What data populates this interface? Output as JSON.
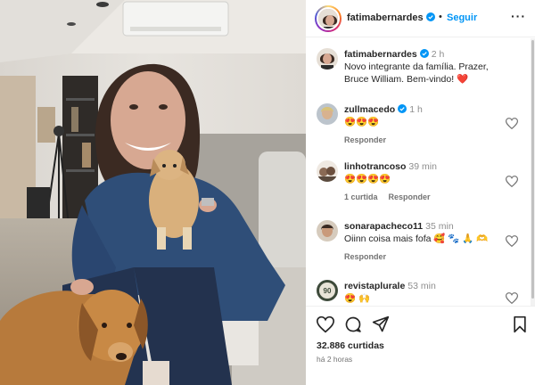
{
  "post": {
    "author": "fatimabernardes",
    "follow_label": "Seguir",
    "separator": "•",
    "more_label": "···",
    "caption": {
      "author": "fatimabernardes",
      "time": "2 h",
      "text": "Novo integrante da família. Prazer, Bruce William. Bem-vindo! ",
      "emoji": "❤️"
    }
  },
  "comments": [
    {
      "user": "zullmacedo",
      "verified": true,
      "time": "1 h",
      "text": "😍😍😍",
      "actions": [
        "Responder"
      ]
    },
    {
      "user": "linhotrancoso",
      "verified": false,
      "time": "39 min",
      "text": "😍😍😍😍",
      "actions": [
        "1 curtida",
        "Responder"
      ]
    },
    {
      "user": "sonarapacheco11",
      "verified": false,
      "time": "35 min",
      "text": "Oiinn coisa mais fofa 🥰 🐾 🙏 🫶",
      "actions": [
        "Responder"
      ]
    },
    {
      "user": "revistaplurale",
      "verified": false,
      "time": "53 min",
      "text": "😍 🙌",
      "actions": []
    }
  ],
  "footer": {
    "likes": "32.886 curtidas",
    "ago": "há 2 horas"
  },
  "icons": {
    "like": "heart-icon",
    "comment": "comment-icon",
    "share": "send-icon",
    "save": "bookmark-icon",
    "verified": "verified-badge-icon"
  },
  "colors": {
    "accent": "#0095f6",
    "verified": "#0095f6",
    "muted": "#737373"
  }
}
